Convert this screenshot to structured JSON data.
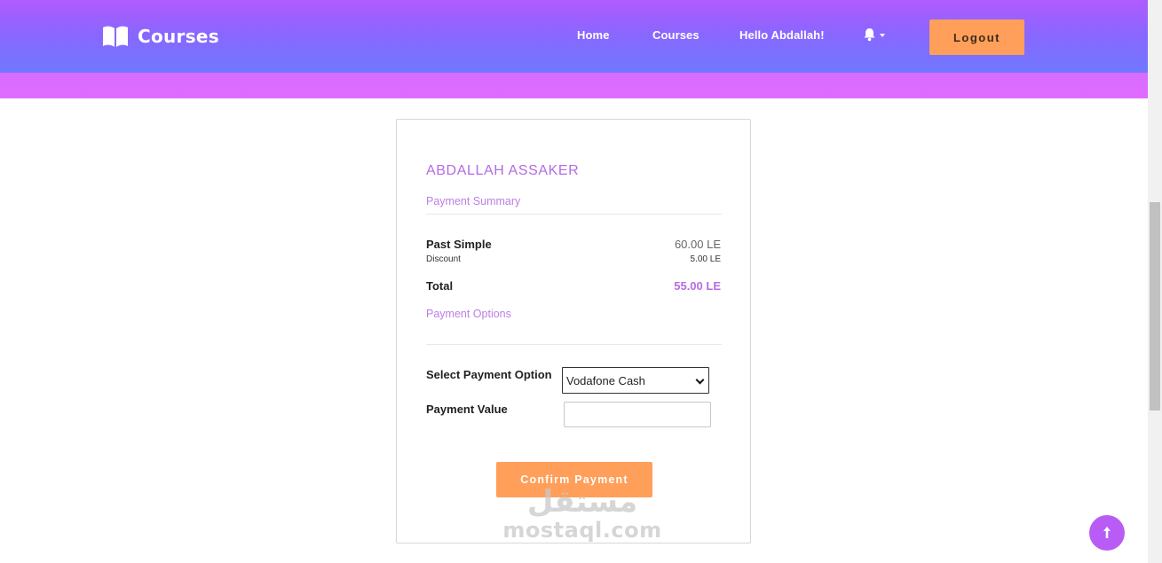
{
  "header": {
    "brand": "Courses",
    "nav": {
      "home": "Home",
      "courses": "Courses",
      "greeting": "Hello Abdallah!"
    },
    "logout_label": "Logout",
    "icons": {
      "brand": "open-book-icon",
      "notification": "bell-icon",
      "dropdown": "caret-down-icon"
    }
  },
  "card": {
    "customer_name": "ABDALLAH ASSAKER",
    "summary_title": "Payment Summary",
    "item": {
      "name": "Past Simple",
      "price": "60.00 LE"
    },
    "discount": {
      "label": "Discount",
      "value": "5.00 LE"
    },
    "total": {
      "label": "Total",
      "value": "55.00 LE"
    },
    "options_title": "Payment Options",
    "payment_option_label": "Select Payment Option",
    "payment_option_selected": "Vodafone Cash",
    "payment_value_label": "Payment Value",
    "payment_value": "",
    "confirm_label": "Confirm Payment"
  },
  "watermark": {
    "arabic": "مستقل",
    "latin": "mostaql.com"
  },
  "back_to_top_icon": "arrow-up-icon",
  "colors": {
    "accent_purple": "#b86be4",
    "button_orange": "#ff9f5a",
    "header_gradient_top": "#b15bff",
    "header_gradient_bottom": "#6f79ff"
  }
}
